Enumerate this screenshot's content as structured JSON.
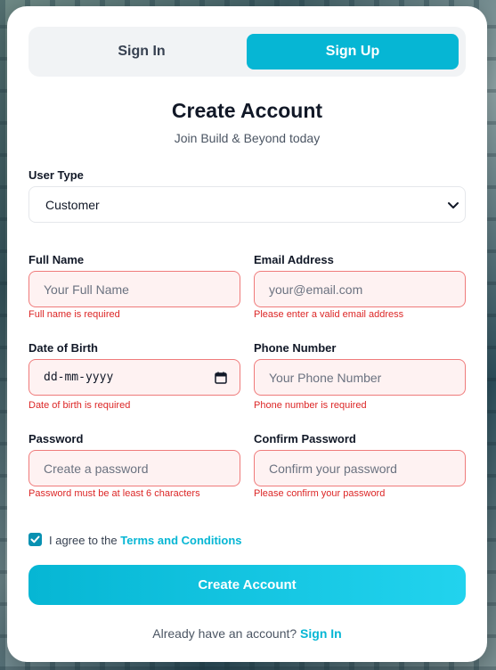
{
  "colors": {
    "accent": "#06b6d4",
    "error": "#dc2626",
    "error_bg": "#fef2f2",
    "error_border": "#ef7b7b"
  },
  "tabs": {
    "signin": "Sign In",
    "signup": "Sign Up",
    "active": "signup"
  },
  "header": {
    "title": "Create Account",
    "subtitle": "Join Build & Beyond today"
  },
  "user_type": {
    "label": "User Type",
    "value": "Customer",
    "icon": "chevron-down-icon"
  },
  "fields": {
    "full_name": {
      "label": "Full Name",
      "placeholder": "Your Full Name",
      "error": "Full name is required"
    },
    "email": {
      "label": "Email Address",
      "placeholder": "your@email.com",
      "error": "Please enter a valid email address"
    },
    "dob": {
      "label": "Date of Birth",
      "placeholder": "dd-mm-yyyy",
      "error": "Date of birth is required",
      "icon": "calendar-icon"
    },
    "phone": {
      "label": "Phone Number",
      "placeholder": "Your Phone Number",
      "error": "Phone number is required"
    },
    "password": {
      "label": "Password",
      "placeholder": "Create a password",
      "error": "Password must be at least 6 characters"
    },
    "confirm_password": {
      "label": "Confirm Password",
      "placeholder": "Confirm your password",
      "error": "Please confirm your password"
    }
  },
  "terms": {
    "checked": true,
    "prefix": "I agree to the ",
    "link": "Terms and Conditions"
  },
  "submit_label": "Create Account",
  "footer": {
    "prefix": "Already have an account? ",
    "link": "Sign In"
  }
}
